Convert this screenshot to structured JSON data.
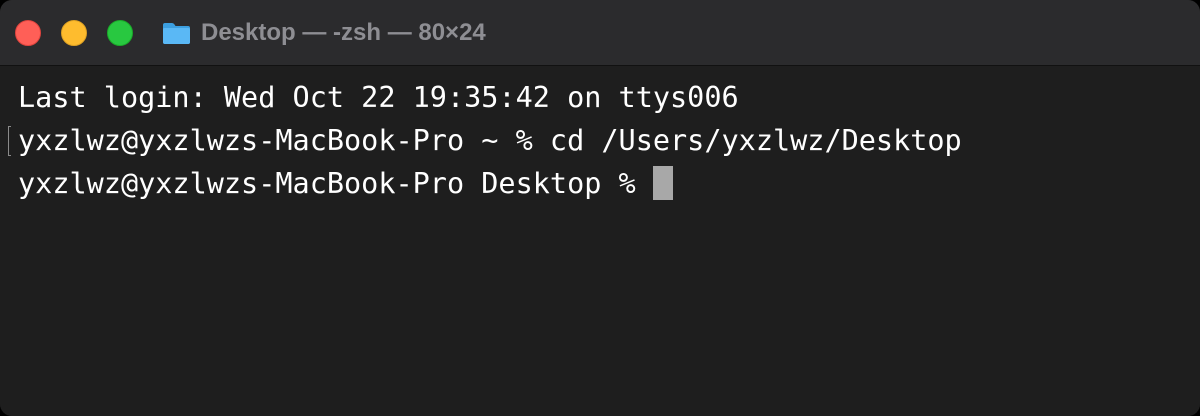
{
  "window": {
    "title": "Desktop — -zsh — 80×24",
    "icon": "folder-icon"
  },
  "traffic_lights": {
    "close": "#ff5f57",
    "minimize": "#febc2e",
    "zoom": "#28c840"
  },
  "terminal": {
    "lines": [
      "Last login: Wed Oct 22 19:35:42 on ttys006",
      "yxzlwz@yxzlwzs-MacBook-Pro ~ % cd /Users/yxzlwz/Desktop",
      "yxzlwz@yxzlwzs-MacBook-Pro Desktop % "
    ],
    "background": "#1e1e1e",
    "foreground": "#ffffff",
    "cursor_color": "#a8a8a8"
  }
}
